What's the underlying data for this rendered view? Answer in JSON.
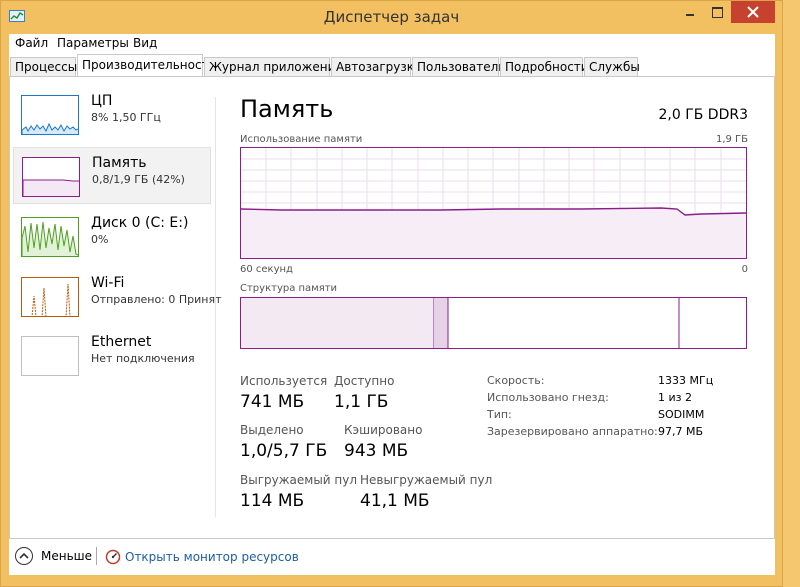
{
  "window": {
    "title": "Диспетчер задач"
  },
  "menu": [
    "Файл",
    "Параметры",
    "Вид"
  ],
  "tabs": [
    {
      "label": "Процессы",
      "active": false
    },
    {
      "label": "Производительность",
      "active": true
    },
    {
      "label": "Журнал приложений",
      "active": false
    },
    {
      "label": "Автозагрузка",
      "active": false
    },
    {
      "label": "Пользователи",
      "active": false
    },
    {
      "label": "Подробности",
      "active": false
    },
    {
      "label": "Службы",
      "active": false
    }
  ],
  "sidebar": [
    {
      "title": "ЦП",
      "sub": "8% 1,50 ГГц",
      "color": "#1e78c8"
    },
    {
      "title": "Память",
      "sub": "0,8/1,9 ГБ (42%)",
      "color": "#8b1d8b",
      "selected": true
    },
    {
      "title": "Диск 0 (C: E:)",
      "sub": "0%",
      "color": "#4da01f"
    },
    {
      "title": "Wi-Fi",
      "sub": "Отправлено: 0 Принят",
      "color": "#b85b0e"
    },
    {
      "title": "Ethernet",
      "sub": "Нет подключения",
      "color": "#bfbfbf"
    }
  ],
  "main": {
    "title": "Память",
    "device": "2,0 ГБ DDR3",
    "usage_label": "Использование памяти",
    "usage_max": "1,9 ГБ",
    "time_left": "60 секунд",
    "time_right": "0",
    "composition_label": "Структура памяти"
  },
  "stats": {
    "in_use_label": "Используется",
    "in_use": "741 МБ",
    "available_label": "Доступно",
    "available": "1,1 ГБ",
    "committed_label": "Выделено",
    "committed": "1,0/5,7 ГБ",
    "cached_label": "Кэшировано",
    "cached": "943 МБ",
    "paged_label": "Выгружаемый пул",
    "paged": "114 МБ",
    "nonpaged_label": "Невыгружаемый пул",
    "nonpaged": "41,1 МБ"
  },
  "details": [
    {
      "label": "Скорость:",
      "value": "1333 МГц"
    },
    {
      "label": "Использовано гнезд:",
      "value": "1 из 2"
    },
    {
      "label": "Тип:",
      "value": "SODIMM"
    },
    {
      "label": "Зарезервировано аппаратно:",
      "value": "97,7 МБ"
    }
  ],
  "footer": {
    "less": "Меньше",
    "resource_monitor": "Открыть монитор ресурсов"
  },
  "colors": {
    "memory": "#8b1d8b",
    "accent_border": "#f2c060",
    "close": "#c7412f"
  }
}
